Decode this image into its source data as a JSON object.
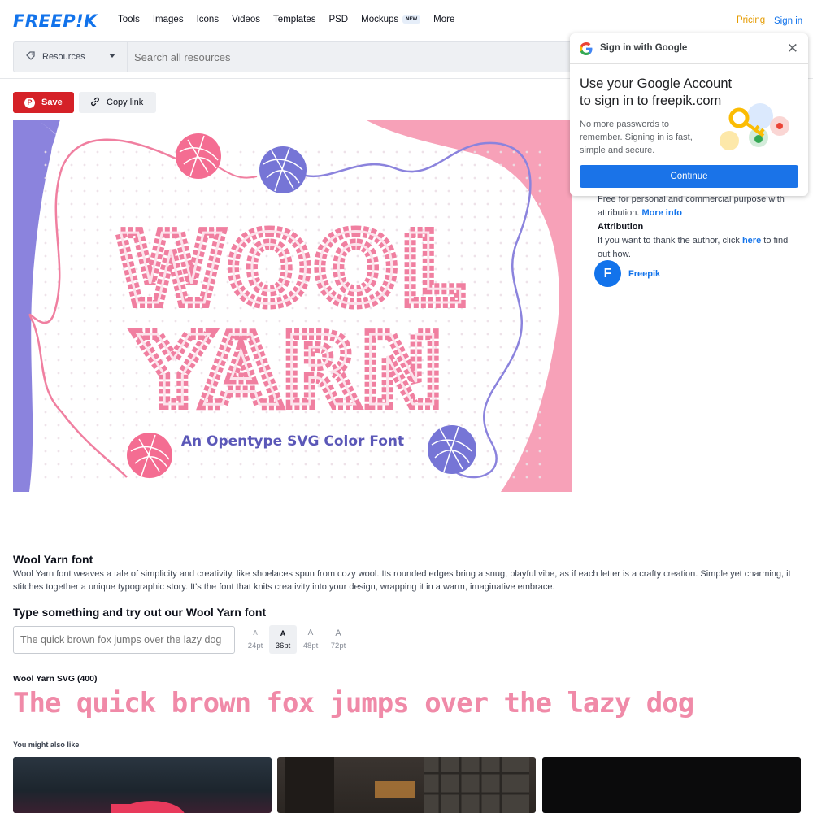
{
  "header": {
    "logo": "FREEP!K",
    "nav": [
      {
        "label": "Tools"
      },
      {
        "label": "Images"
      },
      {
        "label": "Icons"
      },
      {
        "label": "Videos"
      },
      {
        "label": "Templates"
      },
      {
        "label": "PSD"
      },
      {
        "label": "Mockups",
        "badge": "NEW"
      },
      {
        "label": "More"
      }
    ],
    "pricing": "Pricing",
    "signin": "Sign in"
  },
  "search": {
    "category": "Resources",
    "placeholder": "Search all resources"
  },
  "actions": {
    "save": "Save",
    "copy_link": "Copy link"
  },
  "preview": {
    "line1": "WOOL",
    "line2": "YARN",
    "subtitle": "An Opentype SVG Color Font"
  },
  "license": {
    "line1": "Free for personal and commercial purpose with attribution.",
    "more_info": "More info",
    "attribution_title": "Attribution",
    "attribution_pre": "If you want to thank the author, click",
    "attribution_link": "here",
    "attribution_post": "to find out how."
  },
  "author": {
    "name": "Freepik",
    "initial": "F"
  },
  "google": {
    "header": "Sign in with Google",
    "title": "Use your Google Account to sign in to freepik.com",
    "description": "No more passwords to remember. Signing in is fast, simple and secure.",
    "continue": "Continue"
  },
  "font": {
    "title": "Wool Yarn font",
    "description": "Wool Yarn font weaves a tale of simplicity and creativity, like shoelaces spun from cozy wool. Its rounded edges bring a snug, playful vibe, as if each letter is a crafty creation. Simple yet charming, it stitches together a unique typographic story. It's the font that knits creativity into your design, wrapping it in a warm, imaginative embrace.",
    "try_title": "Type something and try out our Wool Yarn font",
    "try_placeholder": "The quick brown fox jumps over the lazy dog",
    "sizes": [
      {
        "glyph": "A",
        "label": "24pt"
      },
      {
        "glyph": "A",
        "label": "36pt"
      },
      {
        "glyph": "A",
        "label": "48pt"
      },
      {
        "glyph": "A",
        "label": "72pt"
      }
    ],
    "selected_size": "36pt",
    "svg_label": "Wool Yarn SVG (400)",
    "sample": "The quick brown fox jumps over the lazy dog"
  },
  "related": {
    "title": "You might also like"
  },
  "colors": {
    "brand_blue": "#1273eb",
    "save_red": "#d52127",
    "pricing_orange": "#e59b00",
    "yarn_pink": "#f08aa8",
    "yarn_purple": "#7b7fd9"
  }
}
